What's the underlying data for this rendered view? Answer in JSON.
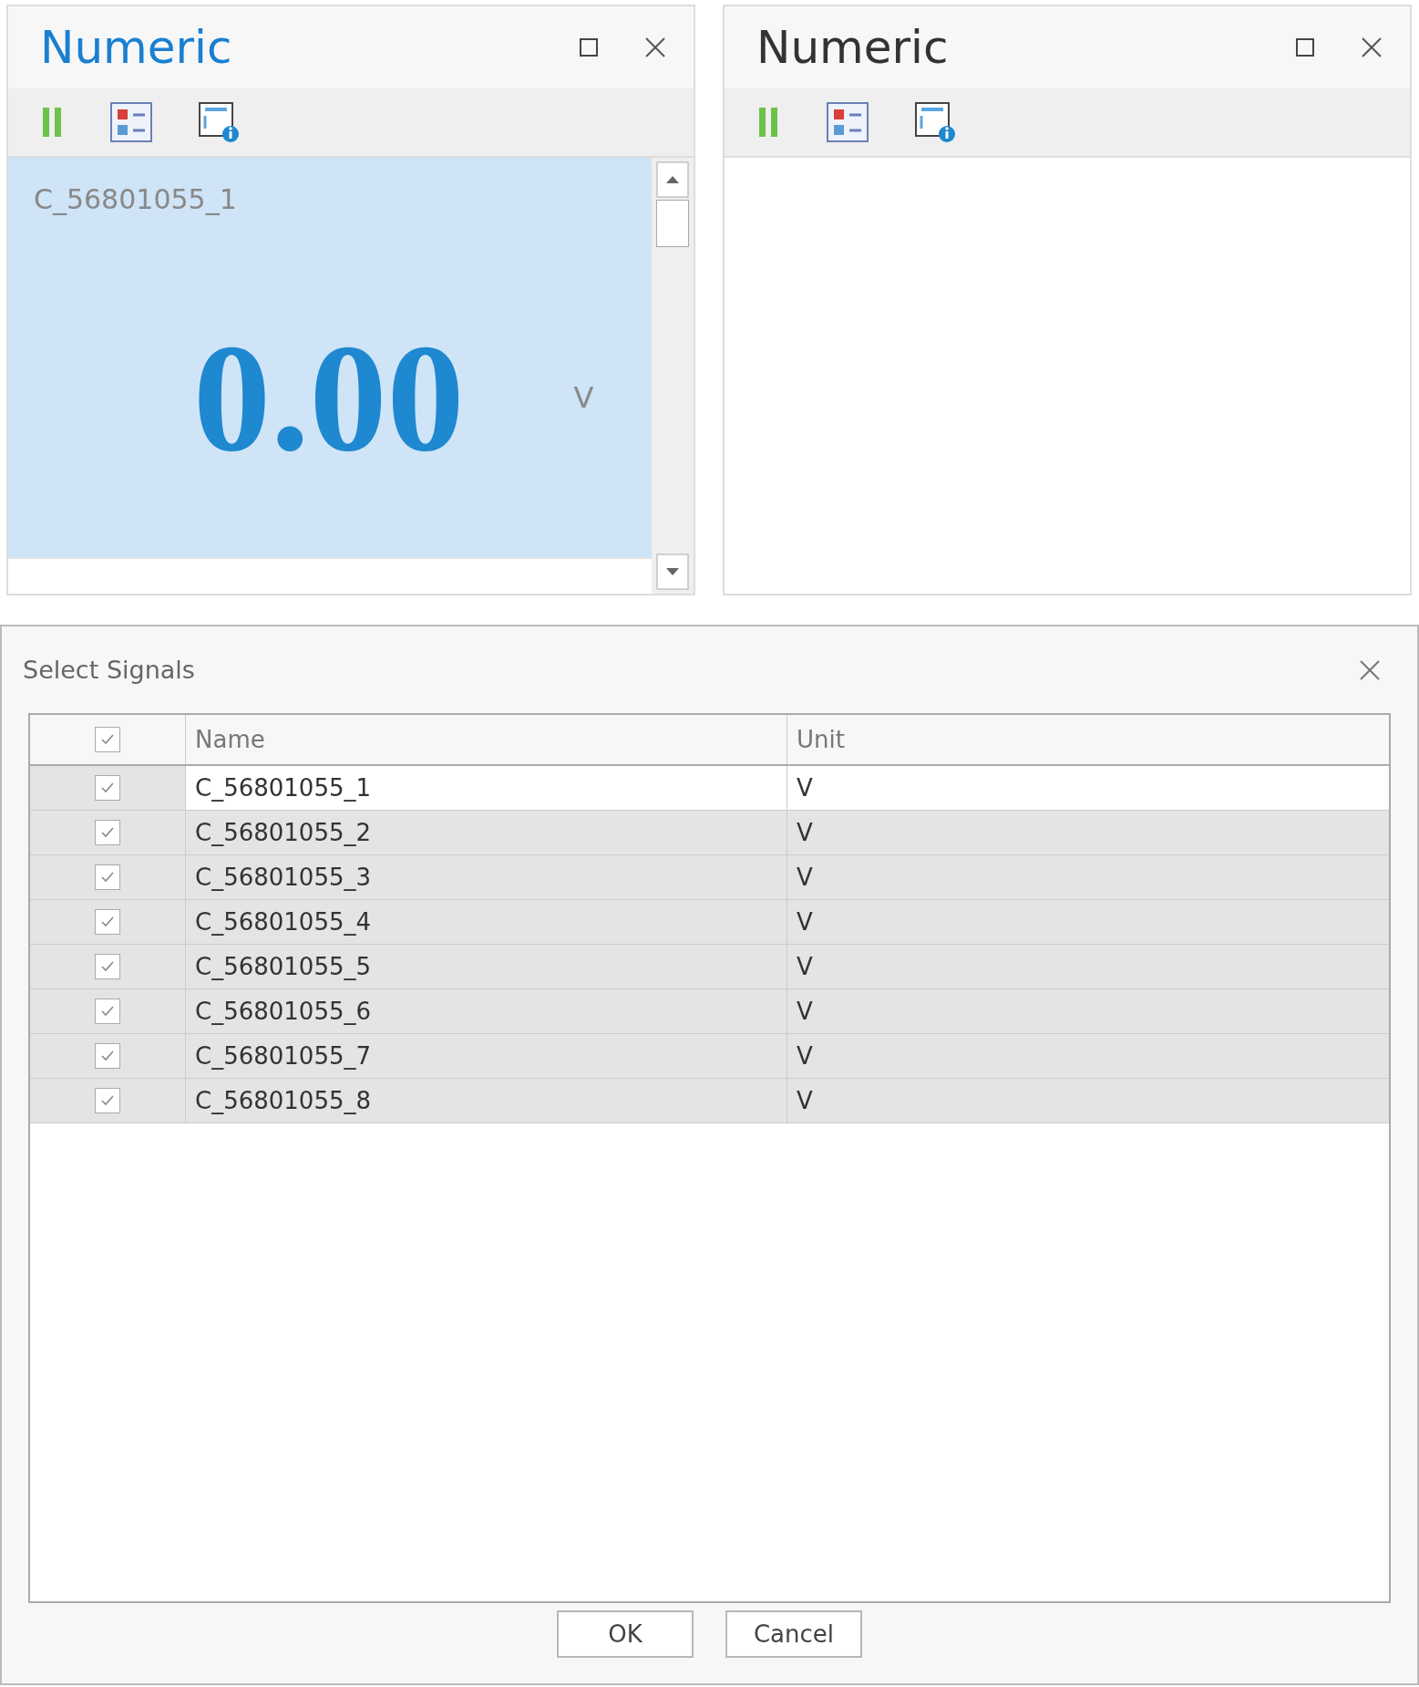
{
  "panels": [
    {
      "title": "Numeric",
      "active": true,
      "readings": [
        {
          "name": "C_56801055_1",
          "value": "0.00",
          "unit": "V",
          "selected": true
        }
      ]
    },
    {
      "title": "Numeric",
      "active": false
    }
  ],
  "dialog": {
    "title": "Select Signals",
    "header_checked": true,
    "columns": [
      "Name",
      "Unit"
    ],
    "rows": [
      {
        "checked": true,
        "selected": true,
        "name": "C_56801055_1",
        "unit": "V"
      },
      {
        "checked": true,
        "selected": false,
        "name": "C_56801055_2",
        "unit": "V"
      },
      {
        "checked": true,
        "selected": false,
        "name": "C_56801055_3",
        "unit": "V"
      },
      {
        "checked": true,
        "selected": false,
        "name": "C_56801055_4",
        "unit": "V"
      },
      {
        "checked": true,
        "selected": false,
        "name": "C_56801055_5",
        "unit": "V"
      },
      {
        "checked": true,
        "selected": false,
        "name": "C_56801055_6",
        "unit": "V"
      },
      {
        "checked": true,
        "selected": false,
        "name": "C_56801055_7",
        "unit": "V"
      },
      {
        "checked": true,
        "selected": false,
        "name": "C_56801055_8",
        "unit": "V"
      }
    ],
    "buttons": [
      "OK",
      "Cancel"
    ]
  }
}
